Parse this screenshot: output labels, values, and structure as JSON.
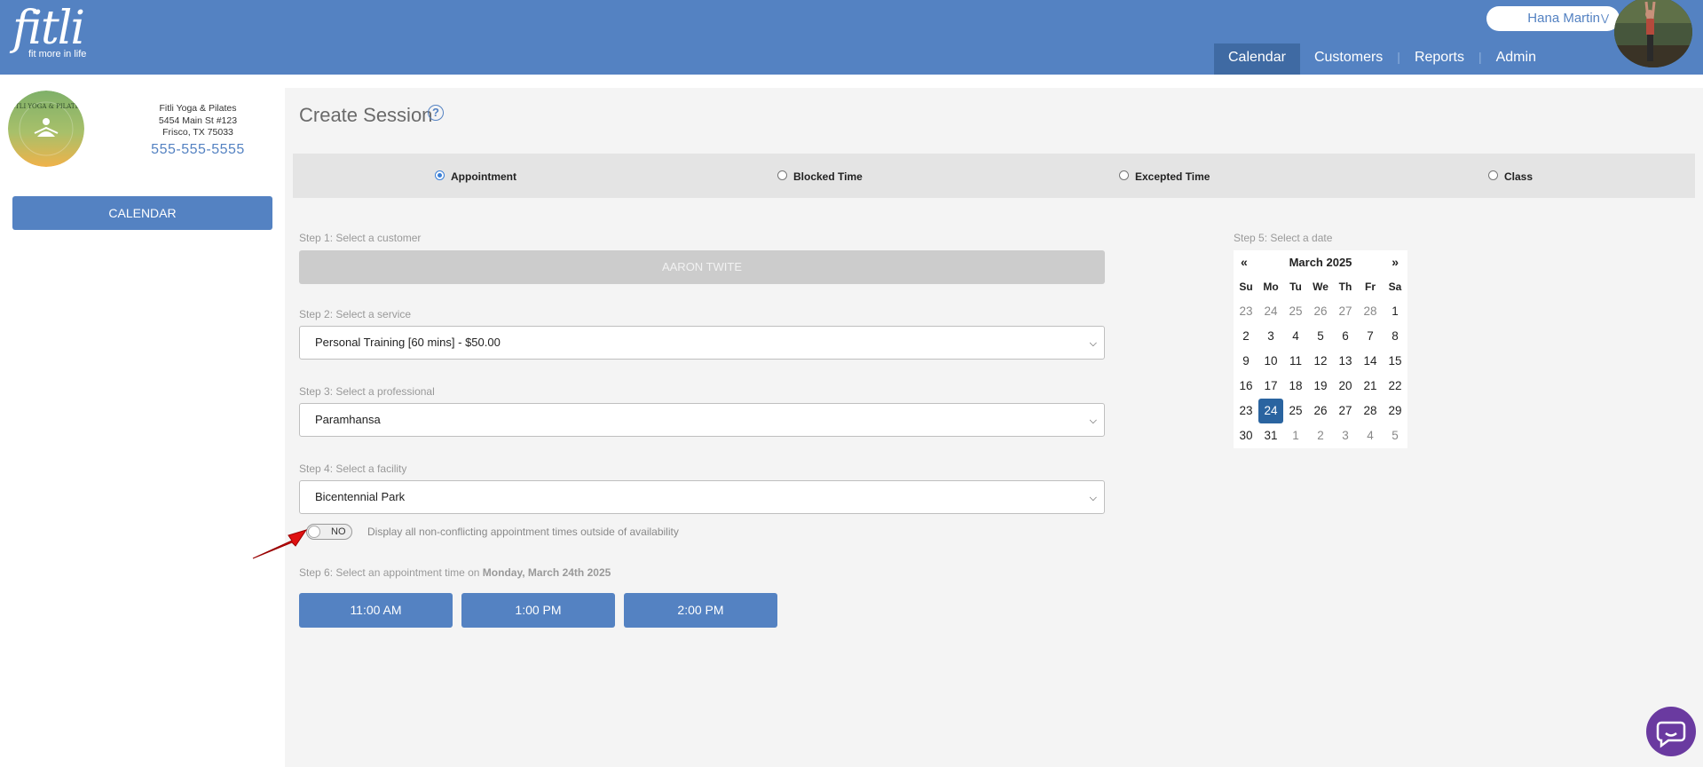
{
  "header": {
    "logo_text": "fitli",
    "logo_tagline": "fit more in life",
    "user_name": "Hana Martin",
    "nav": [
      {
        "label": "Calendar",
        "active": true
      },
      {
        "label": "Customers",
        "active": false
      },
      {
        "label": "Reports",
        "active": false
      },
      {
        "label": "Admin",
        "active": false
      }
    ]
  },
  "sidebar": {
    "business_name": "Fitli Yoga & Pilates",
    "address_line1": "5454 Main St #123",
    "address_line2": "Frisco, TX 75033",
    "phone": "555-555-5555",
    "logo_text": "FITLI YOGA & PILATES",
    "calendar_button": "CALENDAR"
  },
  "main": {
    "title": "Create Session",
    "help_icon": "?",
    "session_types": [
      {
        "label": "Appointment",
        "selected": true
      },
      {
        "label": "Blocked Time",
        "selected": false
      },
      {
        "label": "Excepted Time",
        "selected": false
      },
      {
        "label": "Class",
        "selected": false
      }
    ],
    "step1_label": "Step 1: Select a customer",
    "customer": "AARON TWITE",
    "step2_label": "Step 2: Select a service",
    "service": "Personal Training [60 mins] - $50.00",
    "step3_label": "Step 3: Select a professional",
    "professional": "Paramhansa",
    "step4_label": "Step 4: Select a facility",
    "facility": "Bicentennial Park",
    "toggle_state": "NO",
    "toggle_description": "Display all non-conflicting appointment times outside of availability",
    "step5_label": "Step 5: Select a date",
    "step6_prefix": "Step 6: Select an appointment time on ",
    "step6_date": "Monday, March 24th 2025",
    "times": [
      "11:00 AM",
      "1:00 PM",
      "2:00 PM"
    ]
  },
  "calendar": {
    "prev": "«",
    "next": "»",
    "month_label": "March 2025",
    "weekdays": [
      "Su",
      "Mo",
      "Tu",
      "We",
      "Th",
      "Fr",
      "Sa"
    ],
    "weeks": [
      [
        {
          "d": "23",
          "o": true
        },
        {
          "d": "24",
          "o": true
        },
        {
          "d": "25",
          "o": true
        },
        {
          "d": "26",
          "o": true
        },
        {
          "d": "27",
          "o": true
        },
        {
          "d": "28",
          "o": true
        },
        {
          "d": "1"
        }
      ],
      [
        {
          "d": "2"
        },
        {
          "d": "3"
        },
        {
          "d": "4"
        },
        {
          "d": "5"
        },
        {
          "d": "6"
        },
        {
          "d": "7"
        },
        {
          "d": "8"
        }
      ],
      [
        {
          "d": "9"
        },
        {
          "d": "10"
        },
        {
          "d": "11"
        },
        {
          "d": "12"
        },
        {
          "d": "13"
        },
        {
          "d": "14"
        },
        {
          "d": "15"
        }
      ],
      [
        {
          "d": "16"
        },
        {
          "d": "17"
        },
        {
          "d": "18"
        },
        {
          "d": "19"
        },
        {
          "d": "20"
        },
        {
          "d": "21"
        },
        {
          "d": "22"
        }
      ],
      [
        {
          "d": "23"
        },
        {
          "d": "24",
          "sel": true
        },
        {
          "d": "25"
        },
        {
          "d": "26"
        },
        {
          "d": "27"
        },
        {
          "d": "28"
        },
        {
          "d": "29"
        }
      ],
      [
        {
          "d": "30"
        },
        {
          "d": "31"
        },
        {
          "d": "1",
          "o": true
        },
        {
          "d": "2",
          "o": true
        },
        {
          "d": "3",
          "o": true
        },
        {
          "d": "4",
          "o": true
        },
        {
          "d": "5",
          "o": true
        }
      ]
    ]
  },
  "colors": {
    "brand_blue": "#5482c2",
    "nav_active": "#3f6aa3",
    "selected_day": "#2a64a0",
    "chat_purple": "#6a3aa0",
    "annotation_arrow": "#e01010"
  },
  "icons": {
    "help": "question-circle-icon",
    "user_menu": "chevron-down-icon",
    "select": "chevron-down-icon",
    "chat": "chat-bubble-icon",
    "annotation": "red-arrow-icon"
  }
}
